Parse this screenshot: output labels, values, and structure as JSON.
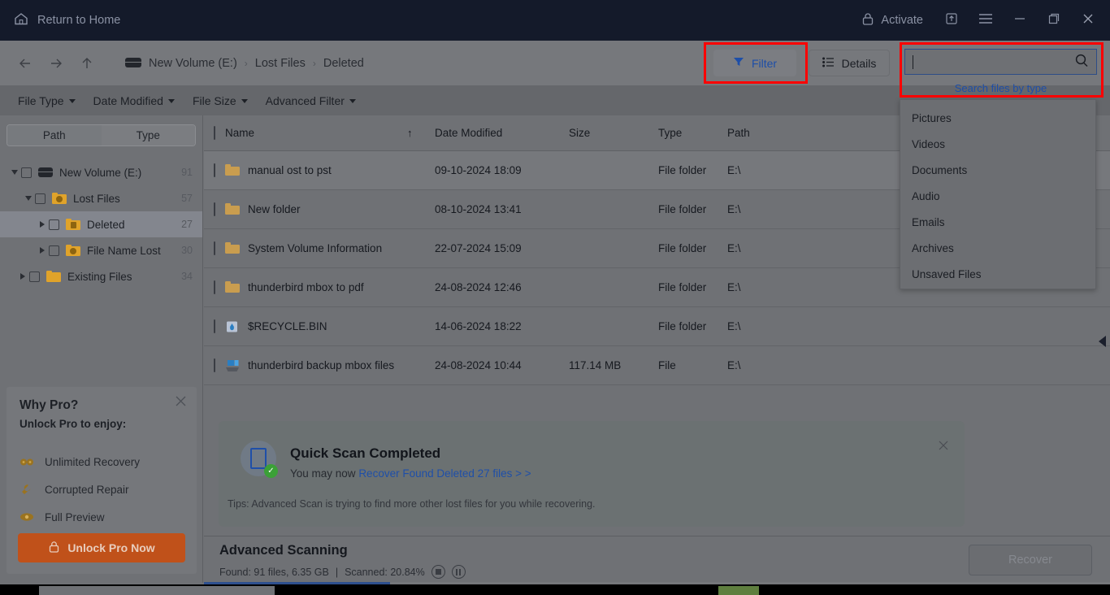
{
  "titlebar": {
    "home_label": "Return to Home",
    "activate_label": "Activate",
    "icons": {
      "home": "home-icon",
      "lock": "lock-icon",
      "upgrade": "upgrade-box-icon",
      "menu": "hamburger-menu-icon",
      "minimize": "minimize-icon",
      "restore": "restore-icon",
      "close": "close-icon"
    }
  },
  "nav": {
    "back": "back-arrow-icon",
    "forward": "forward-arrow-icon",
    "up": "up-arrow-icon",
    "breadcrumb": [
      {
        "label": "New Volume (E:)"
      },
      {
        "label": "Lost Files"
      },
      {
        "label": "Deleted"
      }
    ],
    "separator": "›"
  },
  "filterbar": {
    "items": [
      {
        "label": "File Type"
      },
      {
        "label": "Date Modified"
      },
      {
        "label": "File Size"
      },
      {
        "label": "Advanced Filter"
      }
    ]
  },
  "toolbar": {
    "filter_label": "Filter",
    "details_label": "Details",
    "filter_icon": "funnel-icon",
    "details_icon": "list-details-icon"
  },
  "search": {
    "value": "",
    "placeholder": "",
    "hint": "Search files by type",
    "icon": "search-icon",
    "type_options": [
      "Pictures",
      "Videos",
      "Documents",
      "Audio",
      "Emails",
      "Archives",
      "Unsaved Files"
    ]
  },
  "sidebar": {
    "segmented": {
      "path": "Path",
      "type": "Type",
      "active": "Type"
    },
    "tree": [
      {
        "label": "New Volume (E:)",
        "count": "91",
        "icon": "drive-icon",
        "depth": 0,
        "expanded": true,
        "selected": false
      },
      {
        "label": "Lost Files",
        "count": "57",
        "icon": "lost-folder-icon",
        "depth": 1,
        "expanded": true,
        "selected": false
      },
      {
        "label": "Deleted",
        "count": "27",
        "icon": "deleted-folder-icon",
        "depth": 2,
        "expanded": false,
        "selected": true
      },
      {
        "label": "File Name Lost",
        "count": "30",
        "icon": "filename-lost-folder-icon",
        "depth": 2,
        "expanded": false,
        "selected": false
      },
      {
        "label": "Existing Files",
        "count": "34",
        "icon": "folder-icon",
        "depth": 1,
        "expanded": false,
        "selected": false
      }
    ],
    "whypro": {
      "title": "Why Pro?",
      "subtitle": "Unlock Pro to enjoy:",
      "close_icon": "close-icon",
      "features": [
        {
          "label": "Unlimited Recovery",
          "icon": "infinity-icon"
        },
        {
          "label": "Corrupted Repair",
          "icon": "wrench-icon"
        },
        {
          "label": "Full Preview",
          "icon": "eye-icon"
        }
      ],
      "cta": "Unlock Pro Now",
      "cta_icon": "lock-icon"
    }
  },
  "filelist": {
    "columns": {
      "name": "Name",
      "date_modified": "Date Modified",
      "size": "Size",
      "type": "Type",
      "path": "Path"
    },
    "sort_indicator": "↑",
    "rows": [
      {
        "name": "manual ost to pst",
        "date": "09-10-2024 18:09",
        "size": "",
        "type": "File folder",
        "path": "E:\\",
        "icon": "folder-icon",
        "selected": true
      },
      {
        "name": "New folder",
        "date": "08-10-2024 13:41",
        "size": "",
        "type": "File folder",
        "path": "E:\\",
        "icon": "folder-icon",
        "selected": false
      },
      {
        "name": "System Volume Information",
        "date": "22-07-2024 15:09",
        "size": "",
        "type": "File folder",
        "path": "E:\\",
        "icon": "folder-icon",
        "selected": false
      },
      {
        "name": "thunderbird mbox to pdf",
        "date": "24-08-2024 12:46",
        "size": "",
        "type": "File folder",
        "path": "E:\\",
        "icon": "folder-icon",
        "selected": false
      },
      {
        "name": "$RECYCLE.BIN",
        "date": "14-06-2024 18:22",
        "size": "",
        "type": "File folder",
        "path": "E:\\",
        "icon": "recycle-bin-icon",
        "selected": false
      },
      {
        "name": "thunderbird backup mbox files",
        "date": "24-08-2024 10:44",
        "size": "117.14 MB",
        "type": "File",
        "path": "E:\\",
        "icon": "file-icon",
        "selected": false
      }
    ]
  },
  "banner": {
    "title": "Quick Scan Completed",
    "prefix": "You may now ",
    "link": "Recover Found Deleted 27 files > >",
    "tips": "Tips: Advanced Scan is trying to find more other lost files for you while recovering.",
    "icon": "scan-document-icon",
    "status_icon": "check-circle-icon",
    "close_icon": "close-icon"
  },
  "statusbar": {
    "title": "Advanced Scanning",
    "found": "Found: 91 files, 6.35 GB",
    "divider": "|",
    "scanned": "Scanned: 20.84%",
    "stop_icon": "stop-icon",
    "pause_icon": "pause-icon",
    "recover_label": "Recover",
    "progress_percent": "20.84"
  },
  "colors": {
    "accent_blue": "#1d4ea8",
    "highlight_red": "#ff0000",
    "cta_orange": "#c0511a",
    "titlebar_dark": "#141a2a",
    "progress_blue": "#2d4f8e",
    "success_green": "#3ba037"
  }
}
